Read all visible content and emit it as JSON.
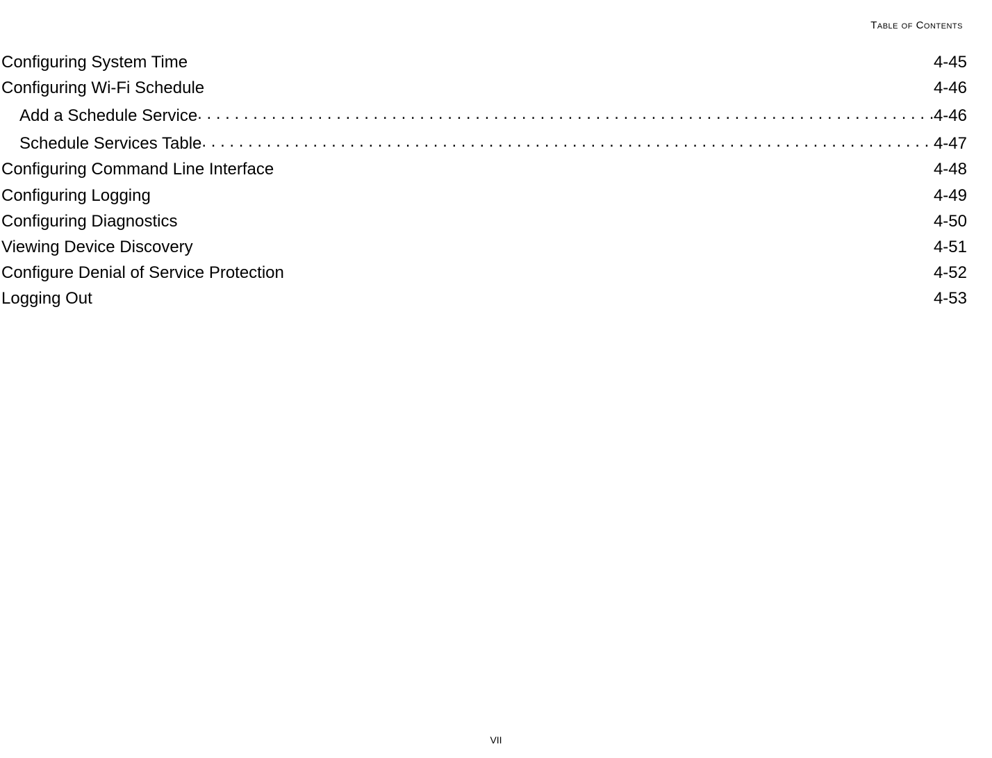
{
  "header": {
    "title": "Table of Contents"
  },
  "toc": {
    "entries": [
      {
        "level": 1,
        "title": "Configuring System Time",
        "page": "4-45",
        "dots": false
      },
      {
        "level": 1,
        "title": "Configuring Wi-Fi Schedule",
        "page": "4-46",
        "dots": false
      },
      {
        "level": 2,
        "title": "Add a Schedule Service ",
        "page": "4-46",
        "dots": true
      },
      {
        "level": 2,
        "title": "Schedule Services Table",
        "page": "4-47",
        "dots": true
      },
      {
        "level": 1,
        "title": "Configuring Command Line Interface",
        "page": "4-48",
        "dots": false
      },
      {
        "level": 1,
        "title": "Configuring Logging",
        "page": "4-49",
        "dots": false
      },
      {
        "level": 1,
        "title": "Configuring Diagnostics",
        "page": "4-50",
        "dots": false
      },
      {
        "level": 1,
        "title": "Viewing Device Discovery",
        "page": "4-51",
        "dots": false
      },
      {
        "level": 1,
        "title": "Configure Denial of Service Protection",
        "page": "4-52",
        "dots": false
      },
      {
        "level": 1,
        "title": "Logging Out",
        "page": "4-53",
        "dots": false
      }
    ]
  },
  "footer": {
    "page_number": "VII"
  }
}
